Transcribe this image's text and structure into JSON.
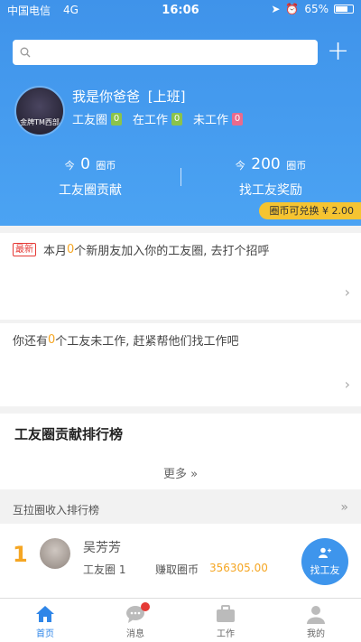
{
  "status_bar": {
    "carrier": "中国电信",
    "network": "4G",
    "time": "16:06",
    "battery": "65%"
  },
  "header": {
    "plus_label": "+",
    "username": "我是你爸爸",
    "status": "[上班]",
    "avatar_text": "金牌TM西部",
    "tags": [
      {
        "label": "工友圈",
        "count": "0"
      },
      {
        "label": "在工作",
        "count": "0"
      },
      {
        "label": "未工作",
        "count": "0"
      }
    ],
    "stats": [
      {
        "prefix": "今",
        "value": "0",
        "unit": "圈币",
        "label": "工友圈贡献"
      },
      {
        "prefix": "今",
        "value": "200",
        "unit": "圈币",
        "label": "找工友奖励"
      }
    ],
    "exchange": "圈币可兑换 ¥ 2.00"
  },
  "cards": {
    "new_badge": "最新",
    "friends_text_pre": "本月",
    "friends_count": "0",
    "friends_text_post": "个新朋友加入你的工友圈, 去打个招呼",
    "idle_text_pre": "你还有",
    "idle_count": "0",
    "idle_text_post": "个工友未工作, 赶紧帮他们找工作吧"
  },
  "ranking": {
    "title": "工友圈贡献排行榜",
    "more": "更多 »"
  },
  "income": {
    "title": "互拉圈收入排行榜",
    "arrow": "»",
    "rows": [
      {
        "rank": "1",
        "name": "吴芳芳",
        "group": "工友圈 1",
        "earn_label": "赚取圈币",
        "earn_value": "356305.00"
      }
    ],
    "find_button": "找工友"
  },
  "tabbar": [
    {
      "label": "首页",
      "icon": "home-icon",
      "active": true
    },
    {
      "label": "消息",
      "icon": "message-icon",
      "active": false
    },
    {
      "label": "工作",
      "icon": "briefcase-icon",
      "active": false
    },
    {
      "label": "我的",
      "icon": "user-icon",
      "active": false
    }
  ],
  "colors": {
    "primary": "#3f93ea",
    "accent": "#f5a623",
    "exchange_bg": "#f5c431"
  }
}
